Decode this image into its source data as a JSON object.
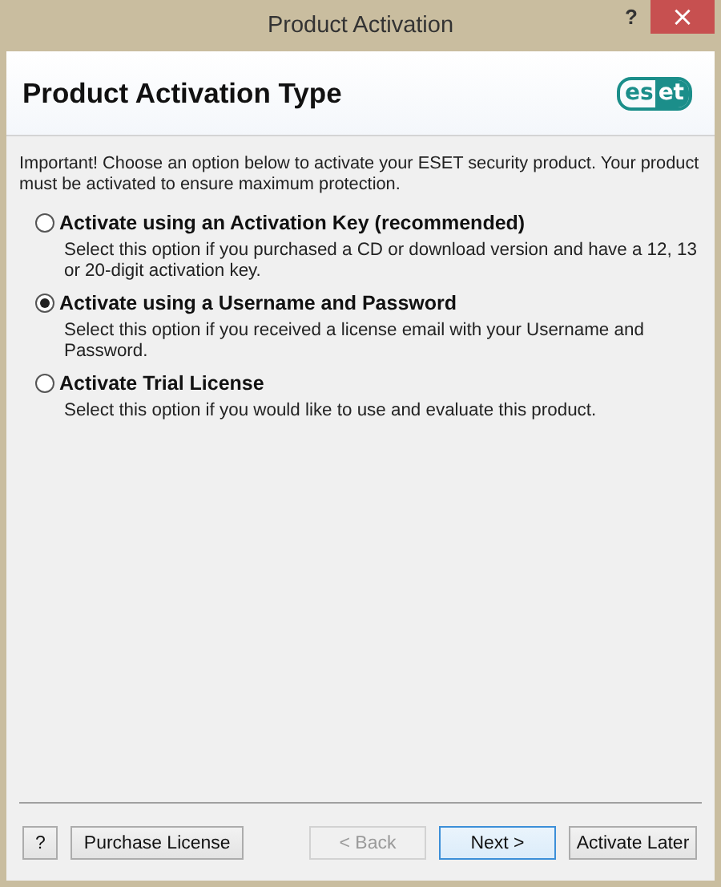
{
  "window": {
    "title": "Product Activation",
    "help": "?",
    "close": "×"
  },
  "header": {
    "title": "Product Activation Type",
    "logo": {
      "outlined": "es",
      "filled": "et"
    }
  },
  "intro": "Important! Choose an option below to activate your ESET security product. Your product must be activated to ensure maximum protection.",
  "options": [
    {
      "label": "Activate using an Activation Key (recommended)",
      "description": "Select this option if you purchased a CD or download version and have a 12, 13 or 20-digit activation key.",
      "selected": false
    },
    {
      "label": "Activate using a Username and Password",
      "description": "Select this option if you received a license email with your Username and Password.",
      "selected": true
    },
    {
      "label": "Activate Trial License",
      "description": "Select this option if you would like to use and evaluate this product.",
      "selected": false
    }
  ],
  "left_buttons": [
    {
      "label": "?",
      "disabled": false,
      "focused": false
    },
    {
      "label": "Purchase License",
      "disabled": false,
      "focused": false
    }
  ],
  "right_buttons": [
    {
      "label": "< Back",
      "disabled": true,
      "focused": false
    },
    {
      "label": "Next >",
      "disabled": false,
      "focused": true
    },
    {
      "label": "Activate Later",
      "disabled": false,
      "focused": false
    }
  ]
}
